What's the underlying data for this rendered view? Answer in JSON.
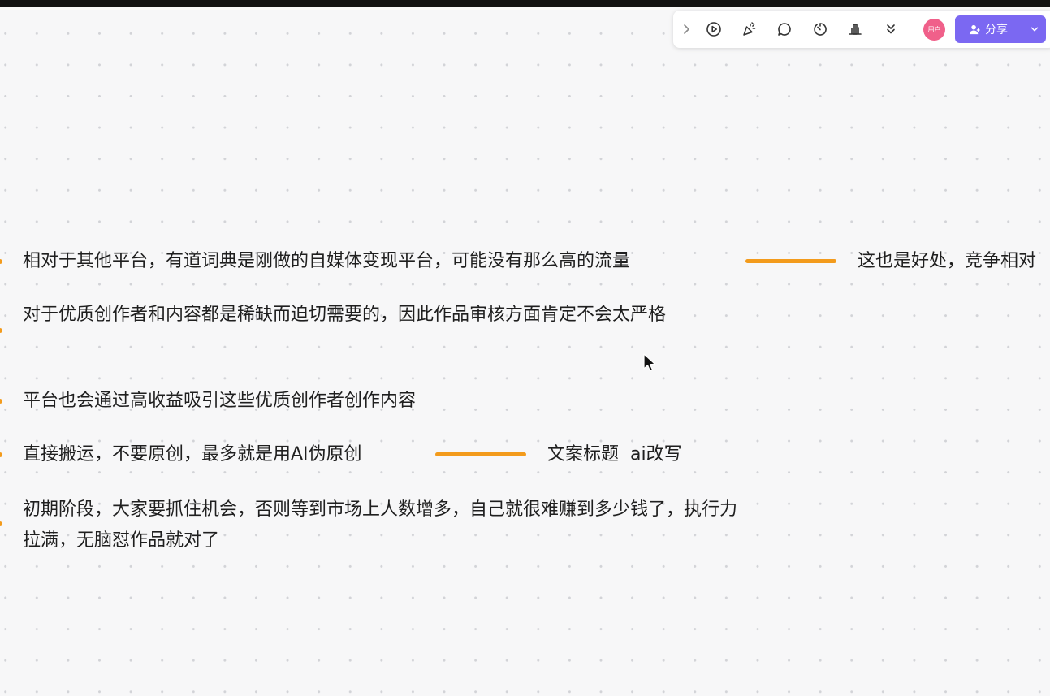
{
  "toolbar": {
    "icons": [
      "chevron-right-icon",
      "play-icon",
      "celebrate-icon",
      "comment-icon",
      "timer-icon",
      "vote-icon",
      "more-down-icon"
    ],
    "avatar_label": "用户",
    "share_label": "分享",
    "accent_color": "#7b68f2"
  },
  "mindmap": {
    "connector_color": "#f39b1c",
    "nodes": [
      {
        "text": "相对于其他平台，有道词典是刚做的自媒体变现平台，可能没有那么高的流量",
        "child": "这也是好处，竞争相对"
      },
      {
        "text": "对于优质创作者和内容都是稀缺而迫切需要的，因此作品审核方面肯定不会太严格"
      },
      {
        "text": "平台也会通过高收益吸引这些优质创作者创作内容"
      },
      {
        "text": "直接搬运，不要原创，最多就是用AI伪原创",
        "child": "文案标题  ai改写"
      },
      {
        "text": "初期阶段，大家要抓住机会，否则等到市场上人数增多，自己就很难赚到多少钱了，执行力拉满，无脑怼作品就对了"
      }
    ]
  }
}
